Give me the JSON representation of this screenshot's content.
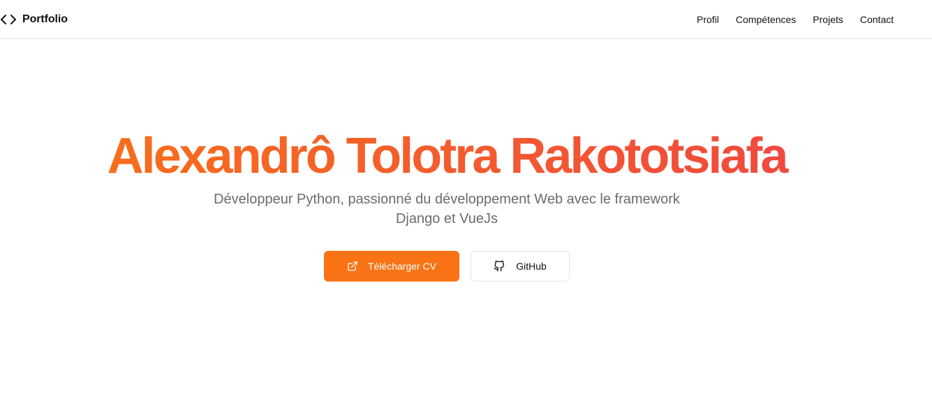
{
  "navbar": {
    "brand": {
      "icon": "code-brackets-icon",
      "label": "Portfolio"
    },
    "links": [
      {
        "label": "Profil"
      },
      {
        "label": "Compétences"
      },
      {
        "label": "Projets"
      },
      {
        "label": "Contact"
      }
    ]
  },
  "hero": {
    "title": "Alexandrô Tolotra Rakototsiafa",
    "subtitle": "Développeur Python, passionné du développement Web avec le framework Django et VueJs",
    "buttons": {
      "primary": {
        "label": "Télécharger CV",
        "icon": "external-link-icon"
      },
      "secondary": {
        "label": "GitHub",
        "icon": "github-icon"
      }
    }
  },
  "colors": {
    "accent": "#f97316",
    "gradient_start": "#f97316",
    "gradient_end": "#ef4444",
    "subtitle": "#6b6b6b",
    "border": "#e6e6e6"
  }
}
